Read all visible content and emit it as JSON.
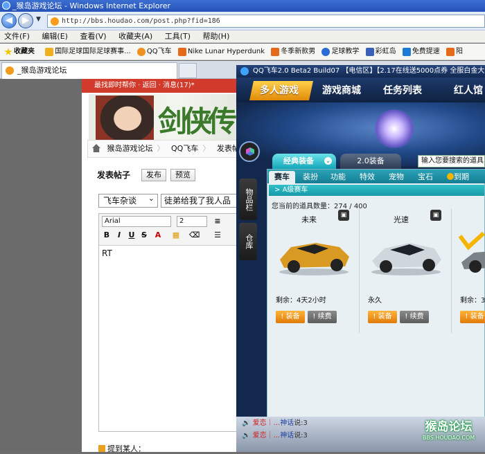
{
  "window": {
    "title": "_猴岛游戏论坛 - Windows Internet Explorer"
  },
  "address": {
    "url": "http://bbs.houdao.com/post.php?fid=186"
  },
  "menu": [
    "文件(F)",
    "编辑(E)",
    "查看(V)",
    "收藏夹(A)",
    "工具(T)",
    "帮助(H)"
  ],
  "favorites": {
    "label": "收藏夹",
    "items": [
      "国际足球国际足球赛事...",
      "QQ飞车",
      "Nike Lunar Hyperdunk",
      "冬季新款男",
      "足球教学",
      "彩虹岛",
      "免费提速",
      "阳"
    ]
  },
  "tab": {
    "label": "_猴岛游戏论坛"
  },
  "forum": {
    "topbar": "最找即时帮你 · 返回 · 消息(17)*",
    "breadcrumb": [
      "猴岛游戏论坛",
      "QQ飞车",
      "发表帖子"
    ],
    "post_title": "发表帖子",
    "publish": "发布",
    "preview": "预览",
    "category": "飞车杂谈",
    "title_value": "徒弟给我了我人品",
    "font": "Arial",
    "size": "2",
    "body": "RT",
    "mention": "提到某人："
  },
  "game": {
    "title": "QQ飞车2.0 Beta2 Build07 【电信区】【2.17在线送5000点券 全服白金大",
    "tabs": [
      "多人游戏",
      "游戏商城",
      "任务列表",
      "红人馆"
    ],
    "side": [
      "物品栏",
      "仓库"
    ],
    "equip_tab": "经典装备",
    "equip2_tab": "2.0装备",
    "search_placeholder": "输入您要搜索的道具",
    "sub_tabs": [
      "赛车",
      "装扮",
      "功能",
      "特效",
      "宠物",
      "宝石",
      "到期"
    ],
    "category": "A级赛车",
    "count_label": "您当前的道具数量：274 / 400",
    "items": [
      {
        "name": "未来",
        "time": "剩余：4天2小时",
        "equip": "装备",
        "renew": "续费"
      },
      {
        "name": "光速",
        "time": "永久",
        "equip": "装备",
        "renew": "续费"
      },
      {
        "name": "",
        "time": "剩余：3",
        "equip": "装备",
        "renew": ""
      }
    ],
    "chat": [
      {
        "pre": "爱恋｜",
        "mid": "...",
        "name": "神话",
        "tail": "说:3"
      },
      {
        "pre": "爱恋｜",
        "mid": "...",
        "name": "神话",
        "tail": "说:3"
      }
    ],
    "watermark": {
      "main": "猴岛论坛",
      "url": "BBS.HOUDAO.COM"
    }
  }
}
